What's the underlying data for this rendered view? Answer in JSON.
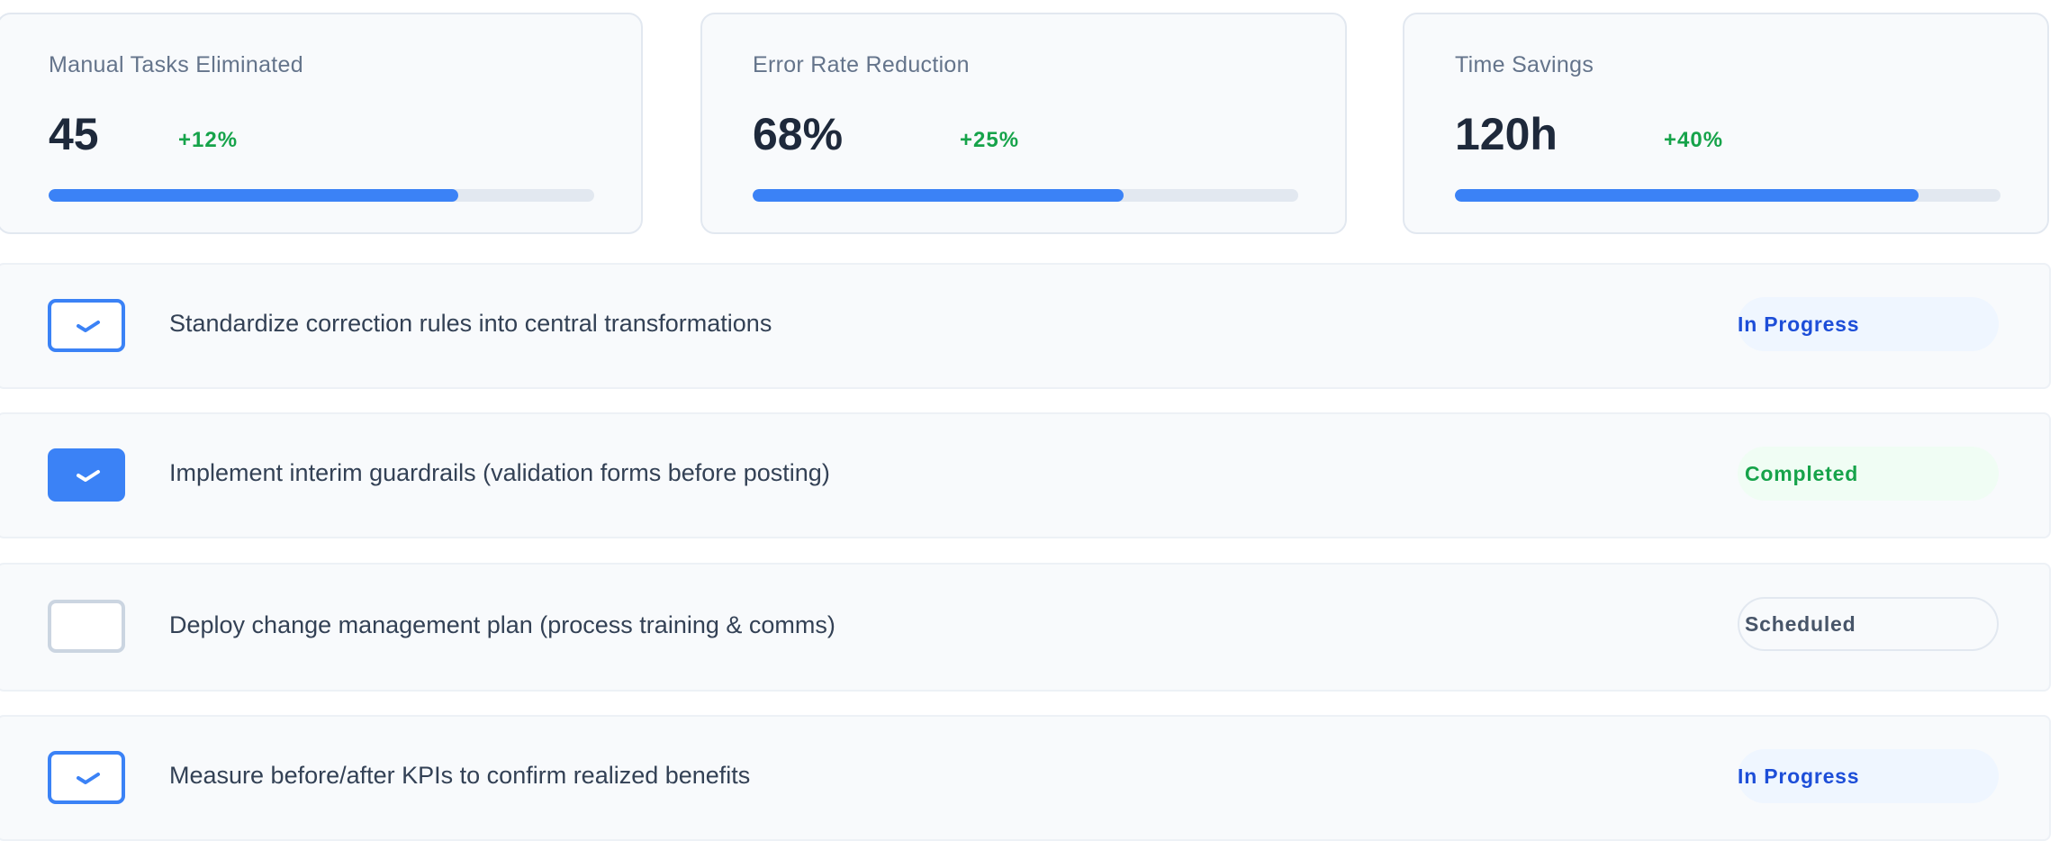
{
  "metrics": [
    {
      "label": "Manual Tasks Eliminated",
      "value": "45",
      "change": "+12%",
      "progress": 0.75
    },
    {
      "label": "Error Rate Reduction",
      "value": "68%",
      "change": "+25%",
      "progress": 0.68
    },
    {
      "label": "Time Savings",
      "value": "120h",
      "change": "+40%",
      "progress": 0.85
    }
  ],
  "colors": {
    "accent": "#3b82f6",
    "positive": "#16a34a",
    "in_progress": "#1d4ed8",
    "neutral": "#475569"
  },
  "tasks": [
    {
      "text": "Standardize correction rules into central transformations",
      "status": "In Progress",
      "checkbox": "checked-outline",
      "icon": "check-icon"
    },
    {
      "text": "Implement interim guardrails (validation forms before posting)",
      "status": "Completed",
      "checkbox": "checked-filled",
      "icon": "check-icon"
    },
    {
      "text": "Deploy change management plan (process training & comms)",
      "status": "Scheduled",
      "checkbox": "unchecked",
      "icon": ""
    },
    {
      "text": "Measure before/after KPIs to confirm realized benefits",
      "status": "In Progress",
      "checkbox": "checked-outline",
      "icon": "check-icon"
    }
  ]
}
